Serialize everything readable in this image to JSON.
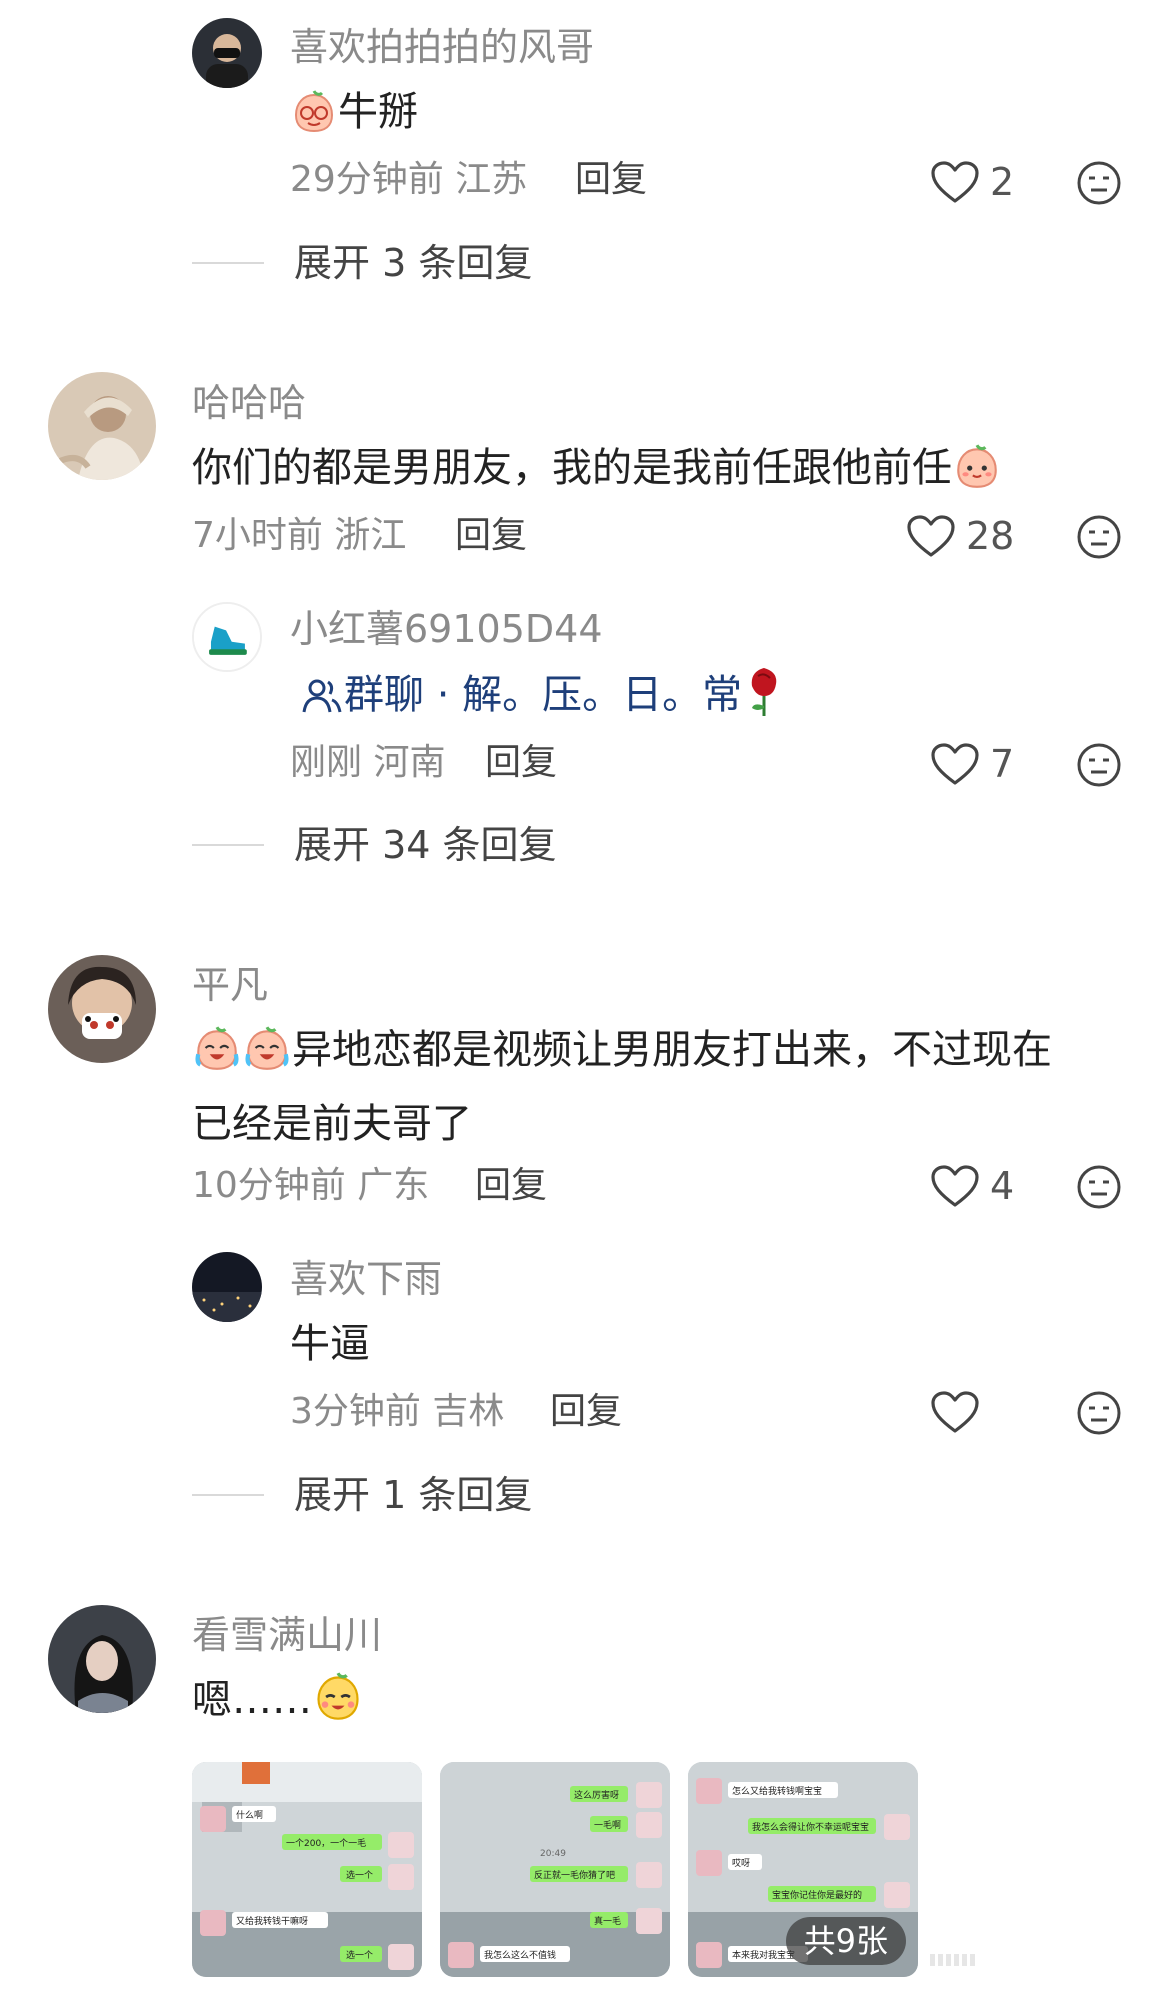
{
  "comments": [
    {
      "user": "喜欢拍拍拍的风哥",
      "text": "牛掰",
      "time": "29分钟前",
      "location": "江苏",
      "reply_label": "回复",
      "likes": "2",
      "expand": "展开 3 条回复"
    },
    {
      "user": "哈哈哈",
      "text": "你们的都是男朋友，我的是我前任跟他前任",
      "time": "7小时前",
      "location": "浙江",
      "reply_label": "回复",
      "likes": "28",
      "reply": {
        "user": "小红薯69105D44",
        "group_text": "群聊 · 解。压。日。常",
        "time": "刚刚",
        "location": "河南",
        "reply_label": "回复",
        "likes": "7"
      },
      "expand": "展开 34 条回复"
    },
    {
      "user": "平凡",
      "text_line1": "异地恋都是视频让男朋友打出来，不过现在",
      "text_line2": "已经是前夫哥了",
      "time": "10分钟前",
      "location": "广东",
      "reply_label": "回复",
      "likes": "4",
      "reply": {
        "user": "喜欢下雨",
        "text": "牛逼",
        "time": "3分钟前",
        "location": "吉林",
        "reply_label": "回复"
      },
      "expand": "展开 1 条回复"
    },
    {
      "user": "看雪满山川",
      "text": "嗯……",
      "image_count": "共9张"
    }
  ],
  "thumbs": {
    "t1": [
      "什么啊",
      "一个200，一个一毛",
      "选一个",
      "又给我转钱干嘛呀",
      "选一个"
    ],
    "t2": [
      "这么厉害呀",
      "一毛啊",
      "20:49",
      "反正就一毛你猜了吧",
      "真一毛",
      "我怎么这么不值钱"
    ],
    "t3": [
      "怎么又给我转钱啊宝宝",
      "我怎么会得让你不幸运呢宝宝",
      "哎呀",
      "宝宝你记住你是最好的",
      "本来我对我宝宝"
    ]
  },
  "colors": {
    "link": "#1e3f7a",
    "muted": "#8a8a8a",
    "text": "#222222"
  }
}
